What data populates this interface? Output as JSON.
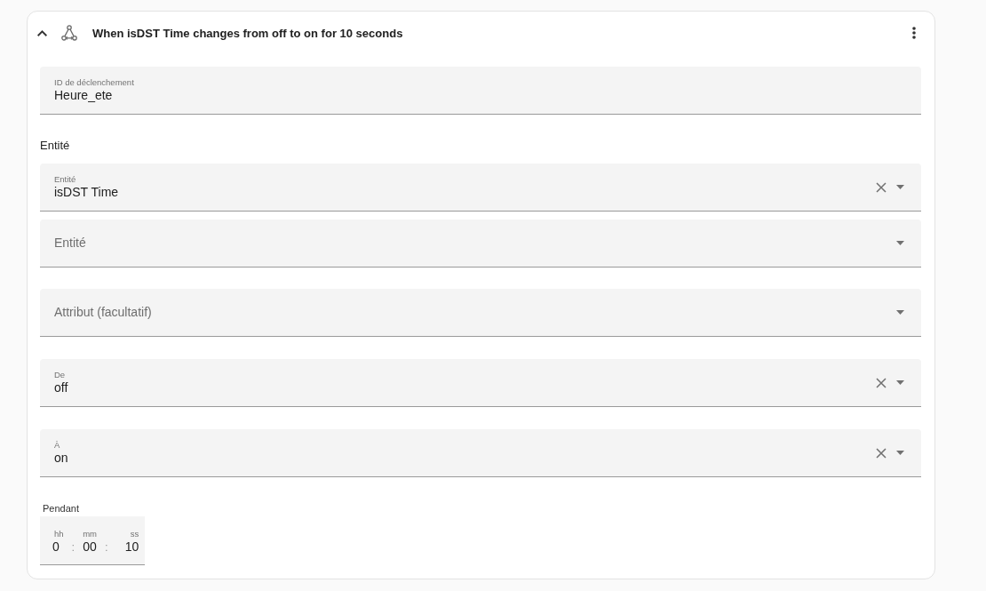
{
  "header": {
    "title": "When isDST Time changes from off to on for 10 seconds",
    "expanded": true
  },
  "trigger_id_field": {
    "label": "ID de déclenchement",
    "value": "Heure_ete"
  },
  "entity_section": {
    "heading": "Entité",
    "fields": [
      {
        "label": "Entité",
        "value": "isDST Time",
        "clearable": true
      },
      {
        "placeholder": "Entité",
        "clearable": false
      }
    ]
  },
  "state_fields": [
    {
      "placeholder": "Attribut (facultatif)",
      "clearable": false
    },
    {
      "label": "De",
      "value": "off",
      "clearable": true
    },
    {
      "label": "À",
      "value": "on",
      "clearable": true
    }
  ],
  "duration": {
    "label": "Pendant",
    "units": [
      {
        "label": "hh",
        "value": "0",
        "separator": ":"
      },
      {
        "label": "mm",
        "value": "00",
        "separator": ":"
      },
      {
        "label": "ss",
        "value": "10"
      }
    ]
  }
}
